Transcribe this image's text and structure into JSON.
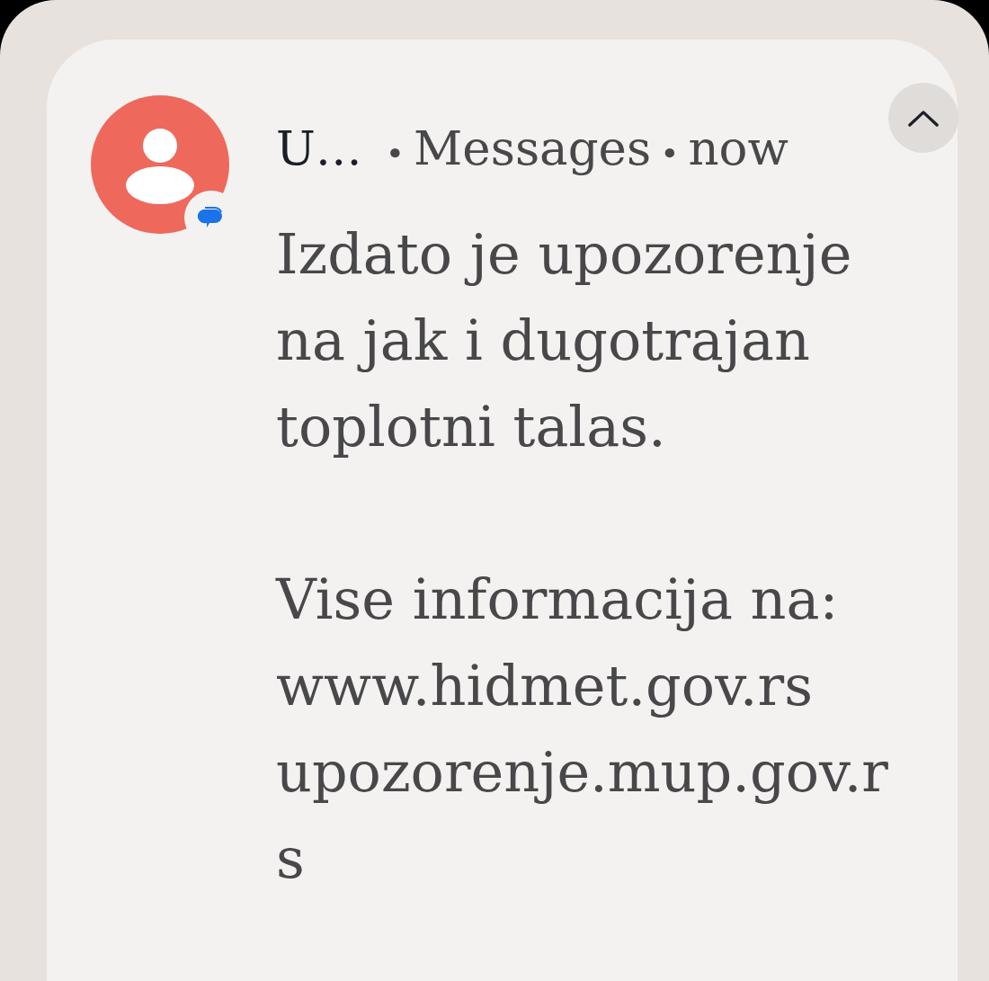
{
  "notification": {
    "expanded": true,
    "header": [
      {
        "kind": "sender",
        "text": "U…"
      },
      {
        "kind": "separator",
        "text": "•"
      },
      {
        "kind": "app",
        "text": "Messages"
      },
      {
        "kind": "separator",
        "text": "•"
      },
      {
        "kind": "time",
        "text": "now"
      }
    ],
    "message": [
      "Izdato je upozorenje\nna jak i dugotrajan\ntoplotni talas.",
      "Vise informacija na:\nwww.hidmet.gov.rs\nupozorenje.mup.gov.r\ns"
    ]
  }
}
